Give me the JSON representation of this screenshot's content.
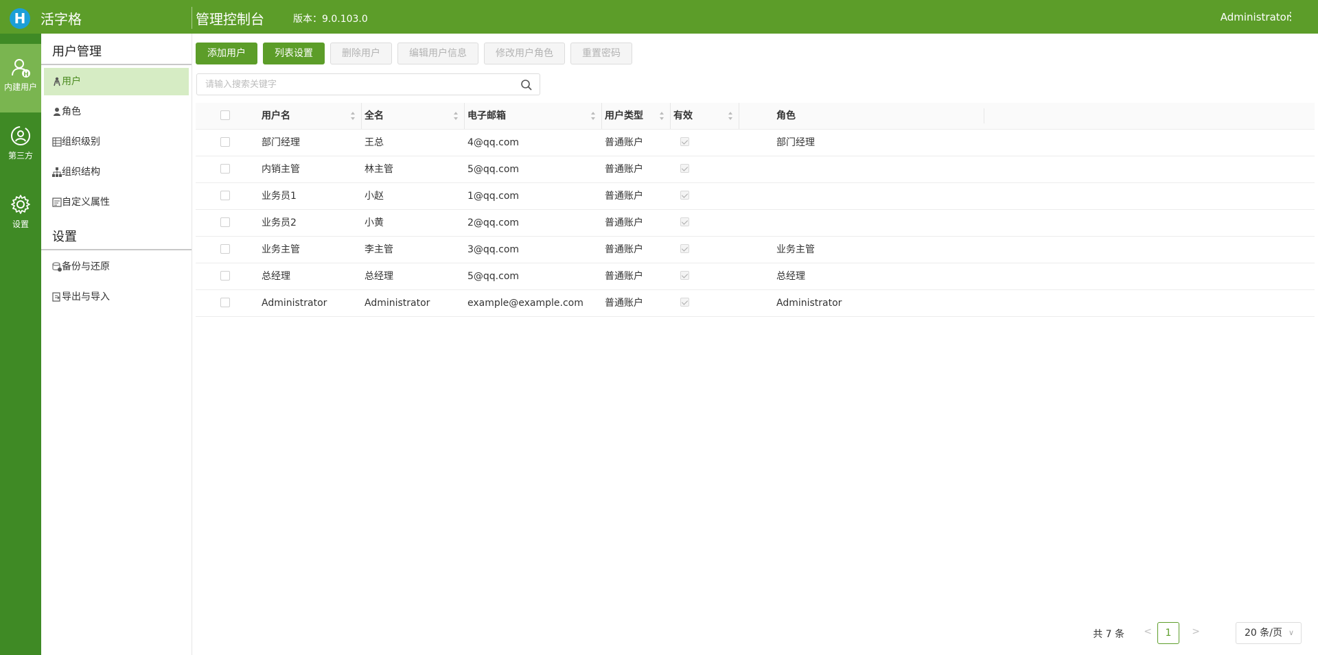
{
  "header": {
    "logo_letter": "H",
    "app_name": "活字格",
    "console_title": "管理控制台",
    "version": "版本：9.0.103.0",
    "user": "Administrator"
  },
  "rail": [
    {
      "label": "内建用户",
      "icon": "user-badge-icon",
      "active": true
    },
    {
      "label": "第三方",
      "icon": "user-sync-icon",
      "active": false
    },
    {
      "label": "设置",
      "icon": "gear-icon",
      "active": false
    }
  ],
  "sidemenu": {
    "user_section": "用户管理",
    "user_items": [
      {
        "label": "用户",
        "icon": "person-icon"
      },
      {
        "label": "角色",
        "icon": "role-icon"
      },
      {
        "label": "组织级别",
        "icon": "org-level-icon"
      },
      {
        "label": "组织结构",
        "icon": "org-tree-icon"
      },
      {
        "label": "自定义属性",
        "icon": "custom-attr-icon"
      }
    ],
    "settings_section": "设置",
    "settings_items": [
      {
        "label": "备份与还原",
        "icon": "backup-icon"
      },
      {
        "label": "导出与导入",
        "icon": "export-import-icon"
      }
    ]
  },
  "toolbar": {
    "add_user": "添加用户",
    "column_settings": "列表设置",
    "delete_user": "删除用户",
    "edit_user": "编辑用户信息",
    "edit_role": "修改用户角色",
    "reset_password": "重置密码"
  },
  "search": {
    "placeholder": "请输入搜索关键字"
  },
  "table": {
    "columns": {
      "username": "用户名",
      "fullname": "全名",
      "email": "电子邮箱",
      "type": "用户类型",
      "valid": "有效",
      "role": "角色"
    },
    "rows": [
      {
        "username": "部门经理",
        "fullname": "王总",
        "email": "4@qq.com",
        "type": "普通账户",
        "valid": true,
        "role": "部门经理"
      },
      {
        "username": "内销主管",
        "fullname": "林主管",
        "email": "5@qq.com",
        "type": "普通账户",
        "valid": true,
        "role": ""
      },
      {
        "username": "业务员1",
        "fullname": "小赵",
        "email": "1@qq.com",
        "type": "普通账户",
        "valid": true,
        "role": ""
      },
      {
        "username": "业务员2",
        "fullname": "小黄",
        "email": "2@qq.com",
        "type": "普通账户",
        "valid": true,
        "role": ""
      },
      {
        "username": "业务主管",
        "fullname": "李主管",
        "email": "3@qq.com",
        "type": "普通账户",
        "valid": true,
        "role": "业务主管"
      },
      {
        "username": "总经理",
        "fullname": "总经理",
        "email": "5@qq.com",
        "type": "普通账户",
        "valid": true,
        "role": "总经理"
      },
      {
        "username": "Administrator",
        "fullname": "Administrator",
        "email": "example@example.com",
        "type": "普通账户",
        "valid": true,
        "role": "Administrator"
      }
    ]
  },
  "pagination": {
    "total": "共 7 条",
    "current_page": "1",
    "prev": "<",
    "next": ">",
    "page_size": "20 条/页"
  },
  "colors": {
    "header": "#5c9d29",
    "rail": "#3f8a25",
    "active_menu": "#d6ecc4"
  }
}
